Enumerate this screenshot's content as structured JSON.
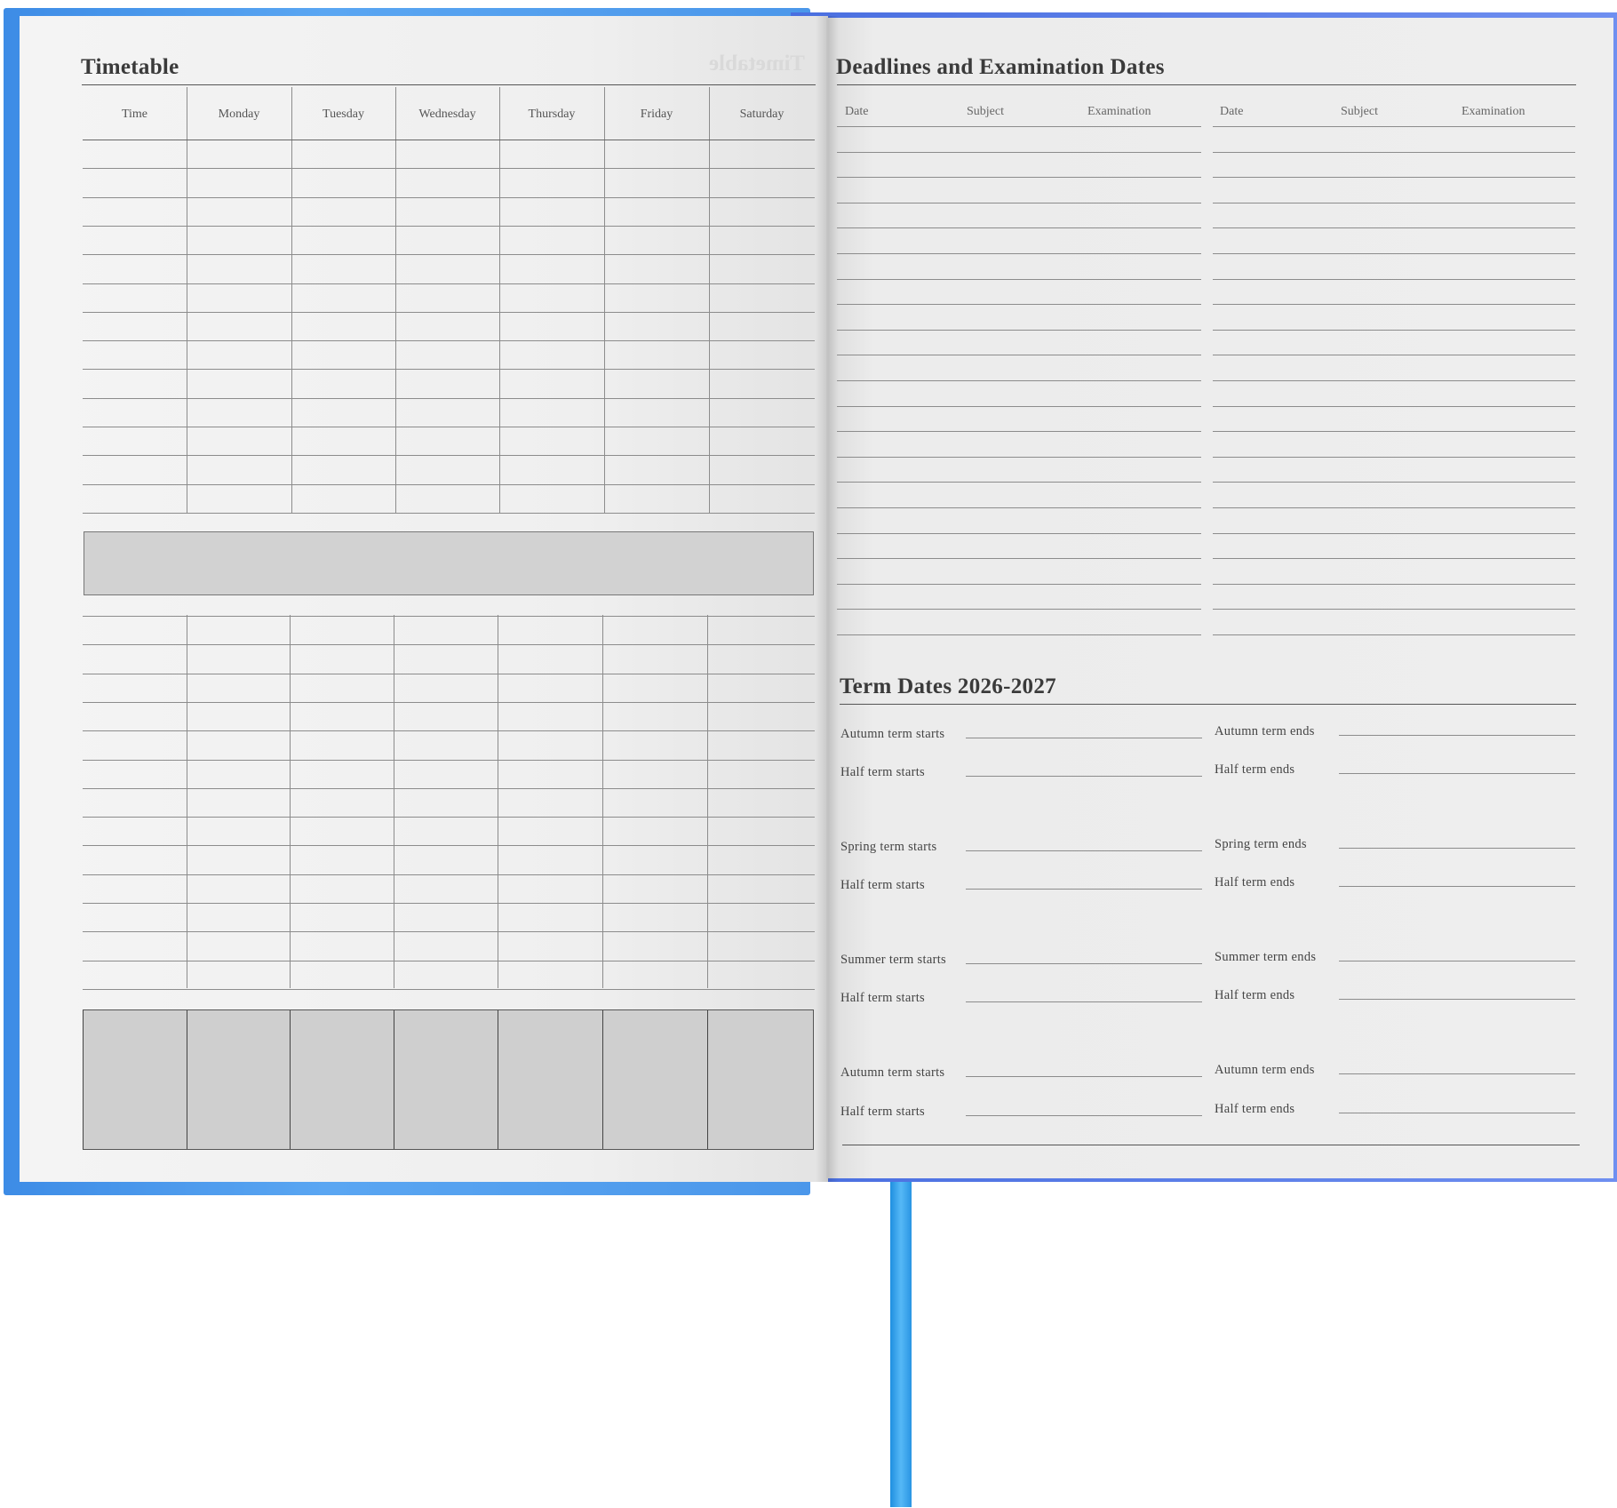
{
  "timetable": {
    "title": "Timetable",
    "ghost_title": "Timetable",
    "columns": [
      "Time",
      "Monday",
      "Tuesday",
      "Wednesday",
      "Thursday",
      "Friday",
      "Saturday"
    ]
  },
  "deadlines": {
    "title": "Deadlines and Examination Dates",
    "columns": [
      "Date",
      "Subject",
      "Examination",
      "Date",
      "Subject",
      "Examination"
    ]
  },
  "term_dates": {
    "title": "Term Dates 2026-2027",
    "rows": [
      {
        "start": "Autumn term starts",
        "end": "Autumn term ends"
      },
      {
        "start": "Half term starts",
        "end": "Half term ends"
      },
      {
        "start": "Spring term starts",
        "end": "Spring term ends"
      },
      {
        "start": "Half term starts",
        "end": "Half term ends"
      },
      {
        "start": "Summer term starts",
        "end": "Summer term ends"
      },
      {
        "start": "Half term starts",
        "end": "Half term ends"
      },
      {
        "start": "Autumn term starts",
        "end": "Autumn term ends"
      },
      {
        "start": "Half term starts",
        "end": "Half term ends"
      }
    ]
  },
  "colors": {
    "cover": "#4b97ea",
    "ribbon": "#3aa6ee",
    "page": "#efefef",
    "grey_band": "#d2d2d2"
  }
}
